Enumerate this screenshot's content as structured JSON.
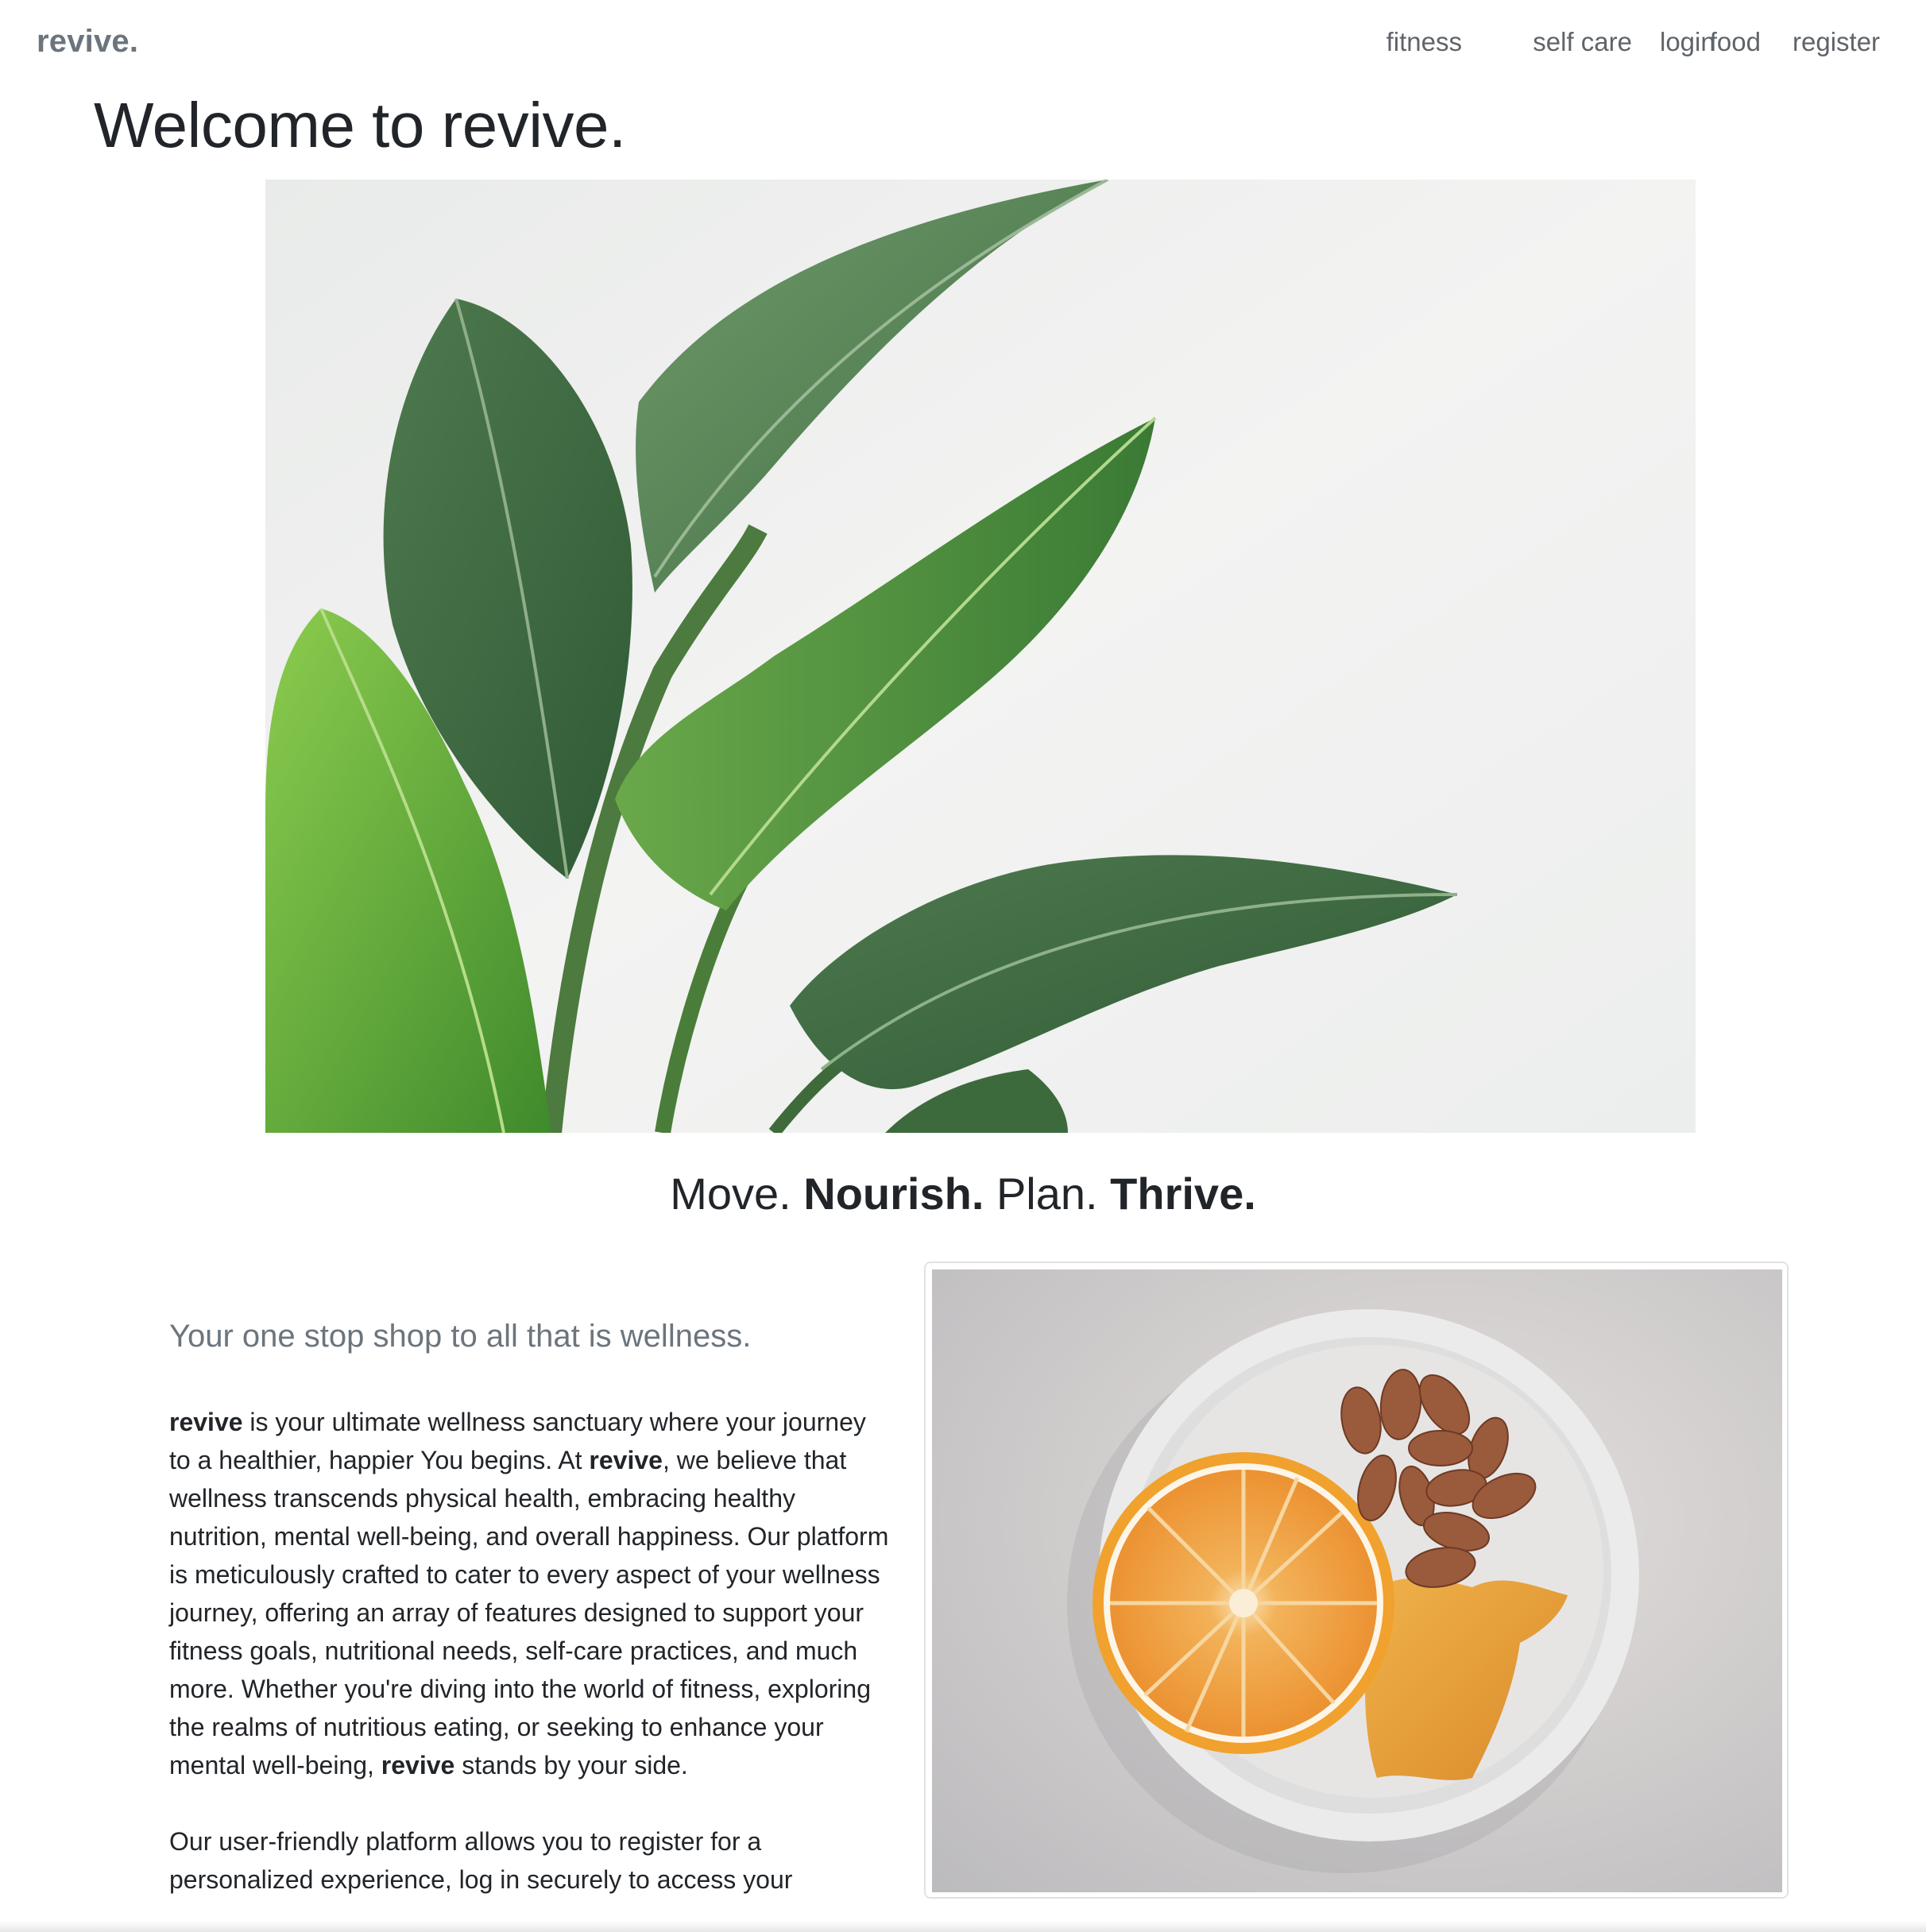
{
  "brand": {
    "name": "revive."
  },
  "nav": {
    "items": [
      {
        "id": "fitness",
        "label": "fitness"
      },
      {
        "id": "self-care",
        "label": "self care"
      },
      {
        "id": "food",
        "label": "food"
      },
      {
        "id": "login",
        "label": "login"
      },
      {
        "id": "register",
        "label": "register"
      }
    ]
  },
  "hero": {
    "title_prefix": "Welcome to ",
    "title_brand": "revive.",
    "image_icon": "banana-plant-leaves-photo"
  },
  "tagline": {
    "move": "Move.",
    "nourish": "Nourish.",
    "plan": "Plan.",
    "thrive": "Thrive."
  },
  "intro": {
    "lead": "Your one stop shop to all that is wellness.",
    "p1": {
      "brand1": "revive",
      "t1": " is your ultimate wellness sanctuary where your journey to a healthier, happier You begins. At ",
      "brand2": "revive",
      "t2": ", we believe that wellness transcends physical health, embracing healthy nutrition, mental well-being, and overall happiness. Our platform is meticulously crafted to cater to every aspect of your wellness journey, offering an array of features designed to support your fitness goals, nutritional needs, self-care practices, and much more. Whether you're diving into the world of fitness, exploring the realms of nutritious eating, or seeking to enhance your mental well-being, ",
      "brand3": "revive",
      "t3": " stands by your side."
    },
    "p2": "Our user-friendly platform allows you to register for a personalized experience, log in securely to access your"
  },
  "card": {
    "image_icon": "orange-almonds-mango-plate-photo"
  },
  "colors": {
    "brand": "#6c757d",
    "nav_link": "#5f6469",
    "heading": "#212529",
    "lead": "#6c757d",
    "card_border": "#dee2e6"
  }
}
